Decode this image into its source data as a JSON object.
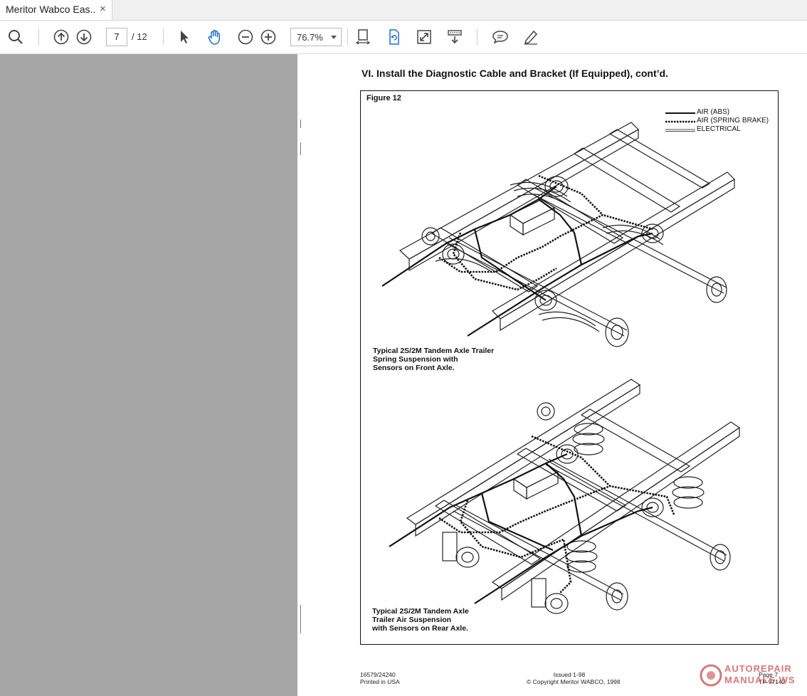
{
  "tab": {
    "title": "Meritor Wabco Eas...",
    "close": "×"
  },
  "toolbar": {
    "search_icon": "search-icon",
    "prev_icon": "arrow-up-circle-icon",
    "next_icon": "arrow-down-circle-icon",
    "page_current": "7",
    "page_total": "/ 12",
    "zoom": "76.7%",
    "icons": [
      "select-arrow-icon",
      "hand-tool-icon",
      "zoom-out-icon",
      "zoom-in-icon",
      "page-fit-icon",
      "rotate-icon",
      "fullscreen-icon",
      "scroll-mode-icon",
      "comment-icon",
      "sign-icon"
    ]
  },
  "document": {
    "heading": "VI.  Install the Diagnostic Cable and Bracket (If Equipped), cont’d.",
    "figure_label": "Figure 12",
    "legend": [
      {
        "label": "AIR (ABS)",
        "style": "solid"
      },
      {
        "label": "AIR (SPRING BRAKE)",
        "style": "dashed"
      },
      {
        "label": "ELECTRICAL",
        "style": "double"
      }
    ],
    "caption_top": [
      "Typical 2S/2M Tandem Axle Trailer",
      "Spring Suspension with",
      "Sensors on Front Axle."
    ],
    "caption_bottom": [
      "Typical 2S/2M Tandem Axle",
      "Trailer Air Suspension",
      "with Sensors on Rear Axle."
    ],
    "footer_left": [
      "16579/24240",
      "Printed in USA"
    ],
    "footer_center": [
      "Issued 1-98",
      "© Copyright Meritor WABCO, 1998"
    ],
    "footer_right": [
      "Page 7",
      "TP-97142"
    ]
  },
  "watermark": {
    "text_line1": "AUTOREPAIR",
    "text_line2": "MANUALS.WS",
    "accent": "#c23a3a"
  }
}
